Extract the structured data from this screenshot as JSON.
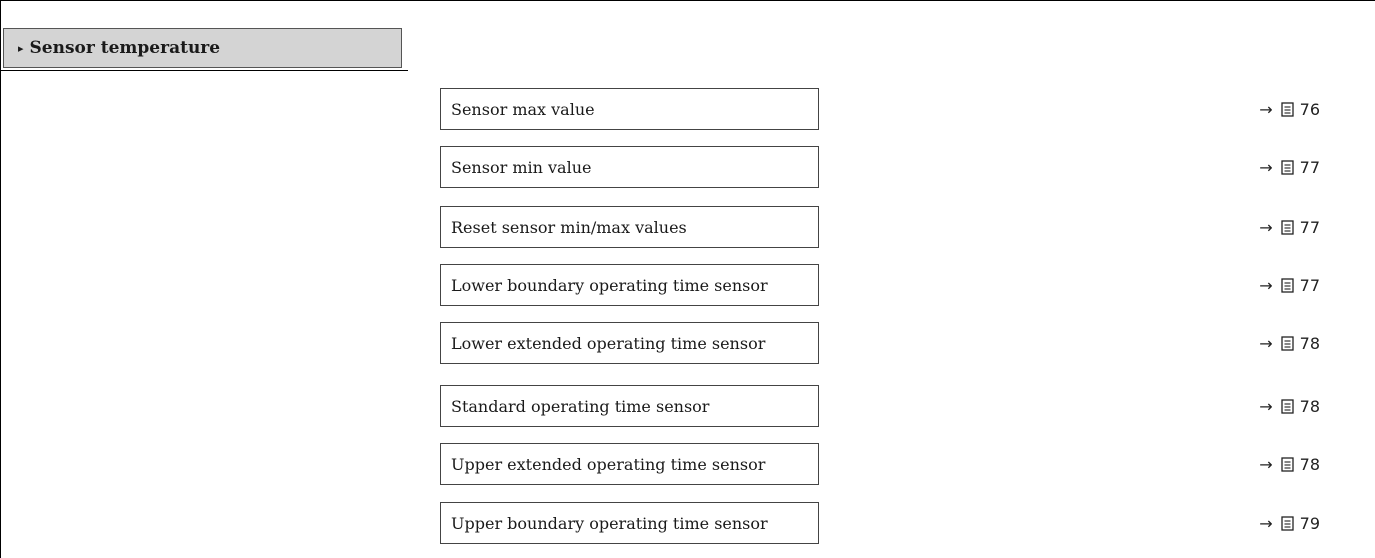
{
  "submenu": {
    "marker": "▸",
    "title": "Sensor temperature"
  },
  "parameters": [
    {
      "label": "Sensor max value",
      "arrow": "→",
      "icon": "document-page-icon",
      "page": "76"
    },
    {
      "label": "Sensor min value",
      "arrow": "→",
      "icon": "document-page-icon",
      "page": "77"
    },
    {
      "label": "Reset sensor min/max values",
      "arrow": "→",
      "icon": "document-page-icon",
      "page": "77"
    },
    {
      "label": "Lower boundary operating time sensor",
      "arrow": "→",
      "icon": "document-page-icon",
      "page": "77"
    },
    {
      "label": "Lower extended operating time sensor",
      "arrow": "→",
      "icon": "document-page-icon",
      "page": "78"
    },
    {
      "label": "Standard operating time sensor",
      "arrow": "→",
      "icon": "document-page-icon",
      "page": "78"
    },
    {
      "label": "Upper extended operating time sensor",
      "arrow": "→",
      "icon": "document-page-icon",
      "page": "78"
    },
    {
      "label": "Upper boundary operating time sensor",
      "arrow": "→",
      "icon": "document-page-icon",
      "page": "79"
    }
  ]
}
